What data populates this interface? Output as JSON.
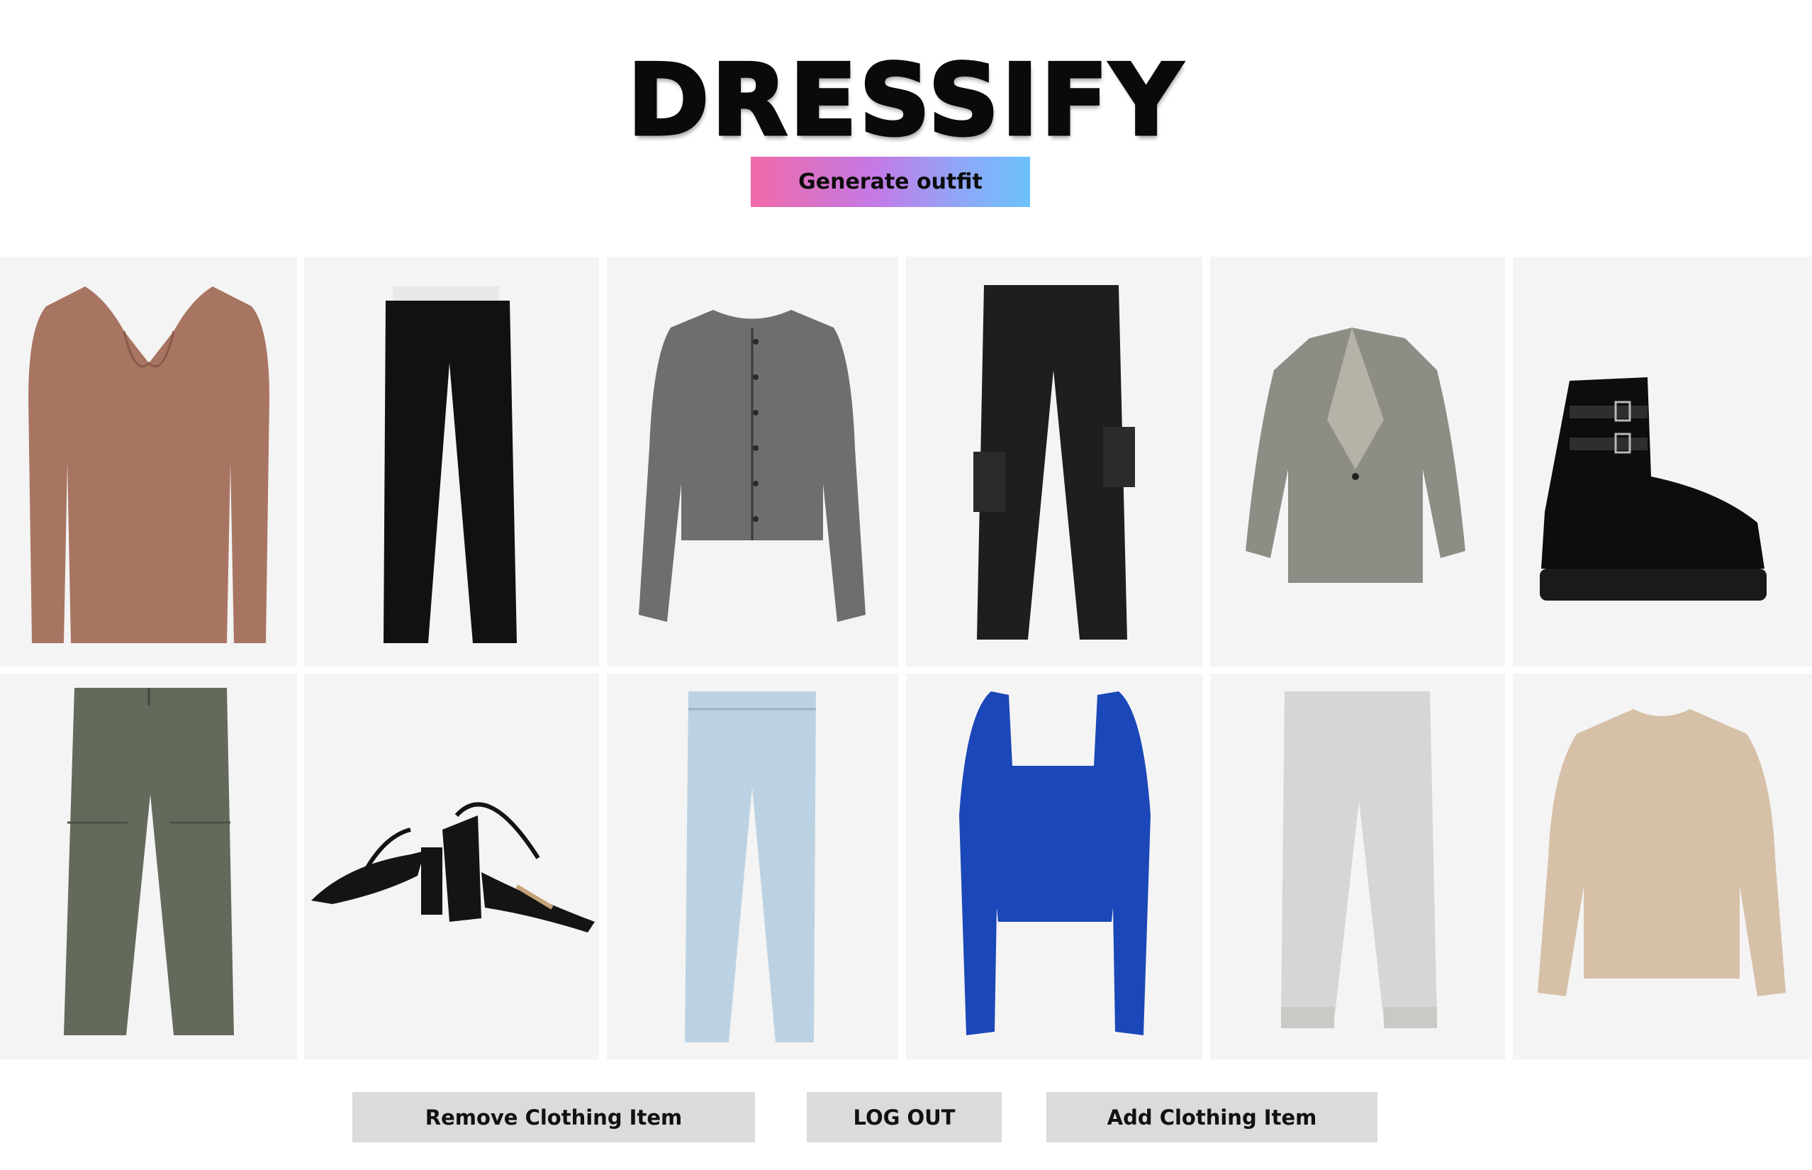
{
  "app": {
    "title": "DRESSIFY"
  },
  "actions": {
    "generate_label": "Generate outfit",
    "remove_label": "Remove Clothing Item",
    "logout_label": "LOG OUT",
    "add_label": "Add Clothing Item"
  },
  "items": [
    {
      "icon": "ribbed-sweetheart-top-icon",
      "color": "#a87562"
    },
    {
      "icon": "black-trousers-icon",
      "color": "#111111"
    },
    {
      "icon": "grey-cable-cardigan-icon",
      "color": "#6e6e6e"
    },
    {
      "icon": "black-cargo-pants-icon",
      "color": "#1e1e1e"
    },
    {
      "icon": "plaid-blazer-icon",
      "color": "#8d8d86"
    },
    {
      "icon": "black-buckle-boots-icon",
      "color": "#0d0d0d"
    },
    {
      "icon": "olive-parachute-pants-icon",
      "color": "#636a5c"
    },
    {
      "icon": "black-strappy-heels-icon",
      "color": "#141414"
    },
    {
      "icon": "light-wash-jeans-icon",
      "color": "#bcd2e2"
    },
    {
      "icon": "blue-square-neck-top-icon",
      "color": "#1b47b8"
    },
    {
      "icon": "light-grey-joggers-icon",
      "color": "#d6d6d4"
    },
    {
      "icon": "beige-fluffy-sweater-icon",
      "color": "#d6c0a8"
    }
  ]
}
